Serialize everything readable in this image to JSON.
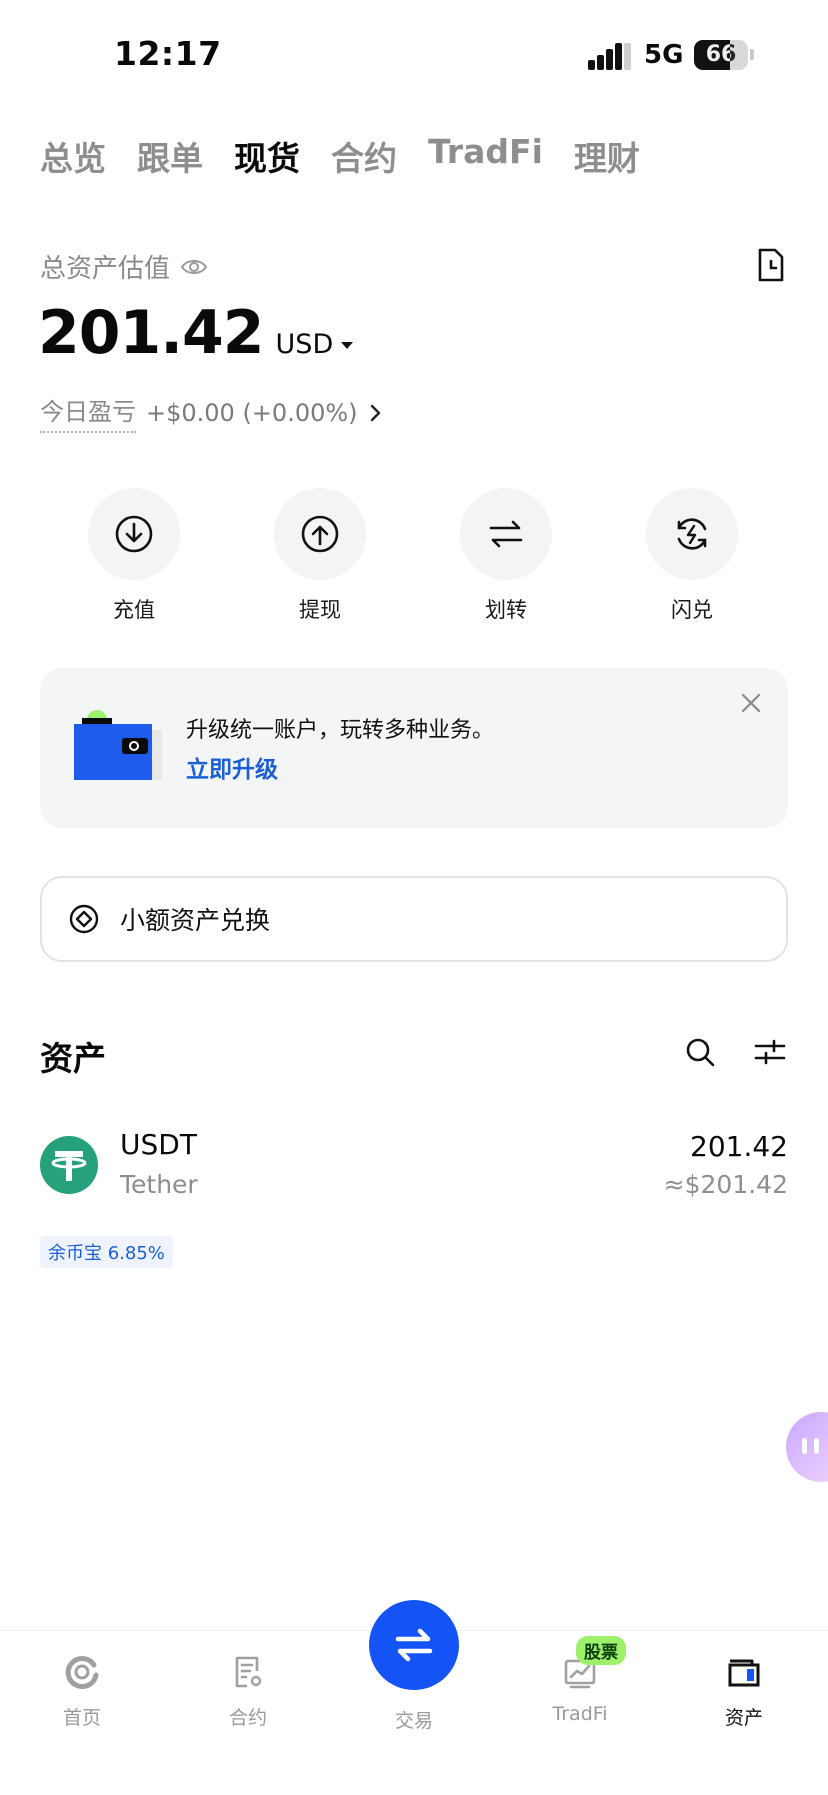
{
  "status_bar": {
    "time": "12:17",
    "network": "5G",
    "battery": "66"
  },
  "top_tabs": [
    {
      "label": "总览",
      "active": false
    },
    {
      "label": "跟单",
      "active": false
    },
    {
      "label": "现货",
      "active": true
    },
    {
      "label": "合约",
      "active": false
    },
    {
      "label": "TradFi",
      "active": false
    },
    {
      "label": "理财",
      "active": false
    }
  ],
  "balance": {
    "label": "总资产估值",
    "value": "201.42",
    "currency": "USD",
    "pnl_label": "今日盈亏",
    "pnl_value": "+$0.00 (+0.00%)"
  },
  "actions": [
    {
      "label": "充值",
      "icon": "deposit-icon"
    },
    {
      "label": "提现",
      "icon": "withdraw-icon"
    },
    {
      "label": "划转",
      "icon": "transfer-icon"
    },
    {
      "label": "闪兑",
      "icon": "flash-convert-icon"
    }
  ],
  "banner": {
    "text": "升级统一账户，玩转多种业务。",
    "link": "立即升级"
  },
  "convert": {
    "label": "小额资产兑换"
  },
  "assets": {
    "title": "资产",
    "items": [
      {
        "symbol": "USDT",
        "name": "Tether",
        "amount": "201.42",
        "usd": "≈$201.42",
        "badge": "余币宝 6.85%"
      }
    ]
  },
  "bottom_nav": {
    "items": [
      {
        "label": "首页"
      },
      {
        "label": "合约"
      },
      {
        "label": "交易"
      },
      {
        "label": "TradFi"
      },
      {
        "label": "资产"
      }
    ],
    "stock_badge": "股票"
  },
  "colors": {
    "accent": "#1453f5",
    "link": "#1a5fd6",
    "tether": "#26a17b",
    "badge_green": "#9cf06a"
  }
}
